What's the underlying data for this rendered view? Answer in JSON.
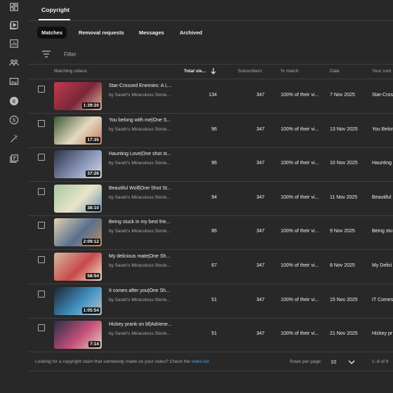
{
  "page": {
    "title": "Copyright"
  },
  "rail": {
    "icons": [
      "dashboard-icon",
      "content-icon",
      "analytics-icon",
      "community-icon",
      "subtitles-icon",
      "copyright-icon",
      "earn-icon",
      "customization-icon",
      "audio-library-icon"
    ]
  },
  "tabs": [
    {
      "label": "Matches",
      "active": true
    },
    {
      "label": "Removal requests",
      "active": false
    },
    {
      "label": "Messages",
      "active": false
    },
    {
      "label": "Archived",
      "active": false
    }
  ],
  "filter": {
    "label": "Filter"
  },
  "columns": {
    "video": "Matching videos",
    "views": "Total vie...",
    "subs": "Subscribers",
    "match": "% match",
    "date": "Date",
    "yours": "Your cont"
  },
  "rows": [
    {
      "title": "Star-Crossed Enemies: A L...",
      "channel": "by Sarah's Miraculous Storie...",
      "duration": "1:39:20",
      "views": "134",
      "subs": "347",
      "match": "100% of their vi...",
      "date": "7 Nov 2025",
      "yours": "Star-Cross",
      "thumb_colors": [
        "#c23a4f",
        "#7a2638",
        "#e8b4a0"
      ]
    },
    {
      "title": "You belong with me|One S...",
      "channel": "by Sarah's Miraculous Storie...",
      "duration": "17:35",
      "views": "96",
      "subs": "347",
      "match": "100% of their vi...",
      "date": "13 Nov 2025",
      "yours": "You Belon",
      "thumb_colors": [
        "#3c5a34",
        "#e5d9c2",
        "#c07a5a"
      ]
    },
    {
      "title": "Haunting Love|One shot st...",
      "channel": "by Sarah's Miraculous Storie...",
      "duration": "37:26",
      "views": "96",
      "subs": "347",
      "match": "100% of their vi...",
      "date": "10 Nov 2025",
      "yours": "Haunting",
      "thumb_colors": [
        "#2c3347",
        "#8792b5",
        "#d6dbe8"
      ]
    },
    {
      "title": "Beautiful Wolf|One Shot St...",
      "channel": "by Sarah's Miraculous Storie...",
      "duration": "38:10",
      "views": "94",
      "subs": "347",
      "match": "100% of their vi...",
      "date": "11 Nov 2025",
      "yours": "Beautiful",
      "thumb_colors": [
        "#a8c8a0",
        "#e9e4c8",
        "#6a8fb0"
      ]
    },
    {
      "title": "Being stuck in my best frie...",
      "channel": "by Sarah's Miraculous Storie...",
      "duration": "2:09:12",
      "views": "86",
      "subs": "347",
      "match": "100% of their vi...",
      "date": "9 Nov 2025",
      "yours": "Being stu",
      "thumb_colors": [
        "#e3d2b0",
        "#5a6f8f",
        "#b8925f"
      ]
    },
    {
      "title": "My delicious mate|One Sh...",
      "channel": "by Sarah's Miraculous Storie...",
      "duration": "58:54",
      "views": "67",
      "subs": "347",
      "match": "100% of their vi...",
      "date": "8 Nov 2025",
      "yours": "My Delici",
      "thumb_colors": [
        "#d9b6a0",
        "#c74a4a",
        "#f1e6d6"
      ]
    },
    {
      "title": "It comes after you|One Sh...",
      "channel": "by Sarah's Miraculous Storie...",
      "duration": "1:05:54",
      "views": "51",
      "subs": "347",
      "match": "100% of their vi...",
      "date": "15 Nov 2025",
      "yours": "IT Comes",
      "thumb_colors": [
        "#1f2430",
        "#3f8fbf",
        "#c0c4cc"
      ]
    },
    {
      "title": "Hickey prank on bf|Adriene...",
      "channel": "by Sarah's Miraculous Storie...",
      "duration": "7:14",
      "views": "51",
      "subs": "347",
      "match": "100% of their vi...",
      "date": "21 Nov 2025",
      "yours": "Hickey pr",
      "thumb_colors": [
        "#2a2f4a",
        "#c44f7a",
        "#e8d0b8"
      ]
    }
  ],
  "footer": {
    "text": "Looking for a copyright claim that somebody made on your video? Check the",
    "link": "video list.",
    "rows_per_page_label": "Rows per page:",
    "rows_per_page_value": "10",
    "range": "1–8 of 8"
  }
}
